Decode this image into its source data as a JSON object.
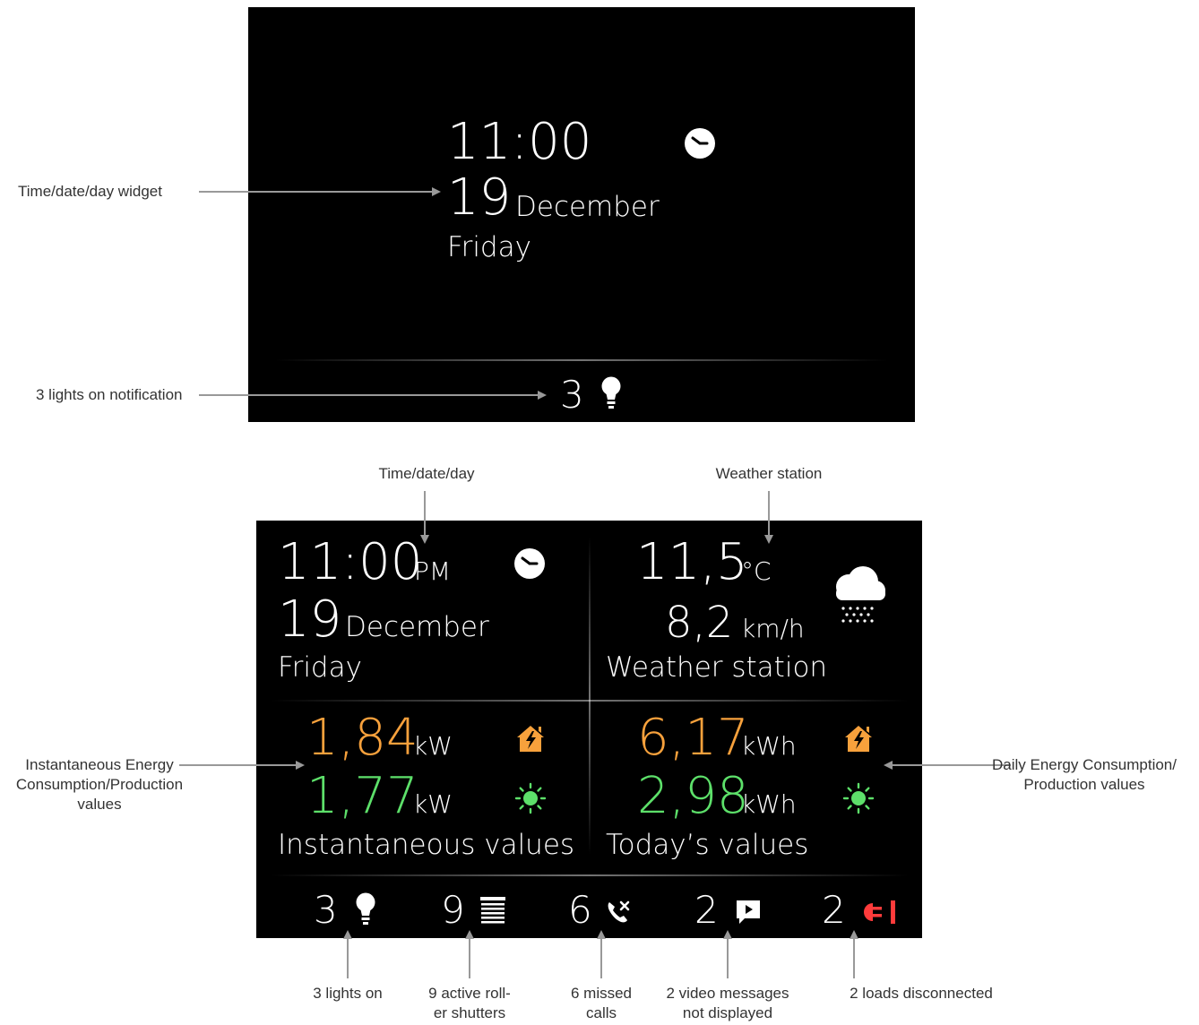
{
  "colors": {
    "consumption": "#f7a13c",
    "production": "#5de06a",
    "disconnected": "#ff3b3b",
    "arrow": "#999999"
  },
  "top_screen": {
    "time": "11:00",
    "day_number": "19",
    "month": "December",
    "weekday": "Friday",
    "clock_icon": "clock-icon",
    "lights_count": "3",
    "lights_icon": "lightbulb-icon"
  },
  "top_annotations": {
    "widget": "Time/date/day widget",
    "lights": "3 lights on notification"
  },
  "bottom_screen": {
    "time": "11:00",
    "ampm": "PM",
    "day_number": "19",
    "month": "December",
    "weekday": "Friday",
    "temperature": "11,5",
    "temperature_unit": "°C",
    "wind": "8,2",
    "wind_unit": "km/h",
    "weather_label": "Weather station",
    "weather_icon": "rain-cloud-icon",
    "inst_consumption": "1,84",
    "inst_consumption_unit": "kW",
    "inst_production": "1,77",
    "inst_production_unit": "kW",
    "inst_label": "Instantaneous values",
    "today_consumption": "6,17",
    "today_consumption_unit": "kWh",
    "today_production": "2,98",
    "today_production_unit": "kWh",
    "today_label": "Today’s values",
    "house_icon": "house-lightning-icon",
    "sun_icon": "sun-icon",
    "notifications": [
      {
        "count": "3",
        "icon": "lightbulb-icon"
      },
      {
        "count": "9",
        "icon": "roller-shutter-icon"
      },
      {
        "count": "6",
        "icon": "missed-call-icon"
      },
      {
        "count": "2",
        "icon": "video-message-icon"
      },
      {
        "count": "2",
        "icon": "plug-disconnected-icon"
      }
    ]
  },
  "bottom_annotations": {
    "time": "Time/date/day",
    "weather": "Weather station",
    "instantaneous": [
      "Instantaneous Energy",
      "Consumption/Production",
      "values"
    ],
    "daily": [
      "Daily Energy Consumption/",
      "Production values"
    ],
    "lights": "3 lights on",
    "shutters": [
      "9 active roll-",
      "er shutters"
    ],
    "calls": [
      "6 missed",
      "calls"
    ],
    "video": [
      "2 video messages",
      "not displayed"
    ],
    "loads": "2 loads disconnected"
  }
}
